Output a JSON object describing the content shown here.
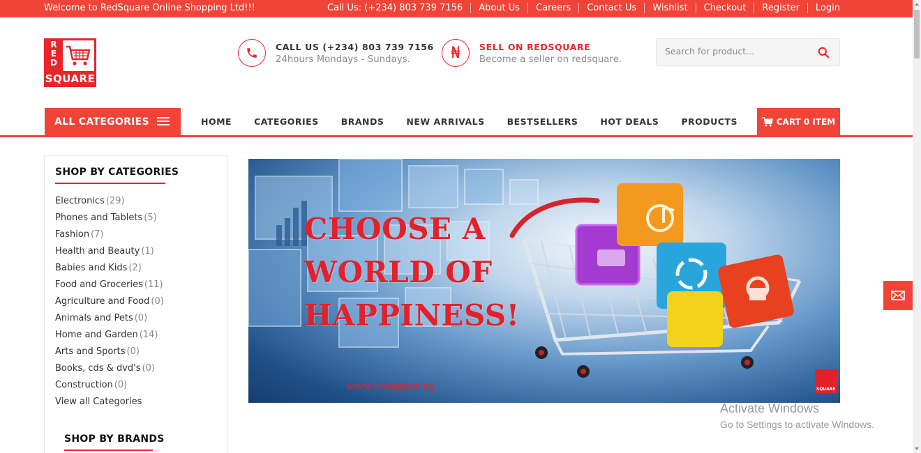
{
  "topbar": {
    "welcome": "Welcome to RedSquare Online Shopping Ltd!!!",
    "links": [
      "Call Us: (+234) 803 739 7156",
      "About Us",
      "Careers",
      "Contact Us",
      "Wishlist",
      "Checkout",
      "Register",
      "Login"
    ]
  },
  "logo": {
    "top": "RED",
    "bottom": "SQUARE"
  },
  "contact": {
    "title": "CALL US (+234) 803 739 7156",
    "subtitle": "24hours Mondays - Sundays.",
    "icon": "phone-icon"
  },
  "sell": {
    "title": "SELL ON REDSQUARE",
    "subtitle": "Become a seller on redsquare.",
    "icon": "naira-icon",
    "symbol": "₦"
  },
  "search": {
    "placeholder": "Search for product..."
  },
  "nav": {
    "all_categories": "ALL CATEGORIES",
    "items": [
      "HOME",
      "CATEGORIES",
      "BRANDS",
      "NEW ARRIVALS",
      "BESTSELLERS",
      "HOT DEALS",
      "PRODUCTS"
    ],
    "cart": "CART 0 ITEM"
  },
  "sidebar": {
    "heading": "SHOP BY CATEGORIES",
    "categories": [
      {
        "name": "Electronics",
        "count": "(29)"
      },
      {
        "name": "Phones and Tablets",
        "count": "(5)"
      },
      {
        "name": "Fashion",
        "count": "(7)"
      },
      {
        "name": "Health and Beauty",
        "count": "(1)"
      },
      {
        "name": "Babies and Kids",
        "count": "(2)"
      },
      {
        "name": "Food and Groceries",
        "count": "(11)"
      },
      {
        "name": "Agriculture and Food",
        "count": "(0)"
      },
      {
        "name": "Animals and Pets",
        "count": "(0)"
      },
      {
        "name": "Home and Garden",
        "count": "(14)"
      },
      {
        "name": "Arts and Sports",
        "count": "(0)"
      },
      {
        "name": "Books, cds & dvd's",
        "count": "(0)"
      },
      {
        "name": "Construction",
        "count": "(0)"
      }
    ],
    "view_all": "View all Categories",
    "brands_heading": "SHOP BY BRANDS"
  },
  "banner": {
    "line1": "CHOOSE A",
    "line2": "WORLD OF",
    "line3": "HAPPINESS!",
    "url": "www.redsquare.ng",
    "mini_logo": "SQUARE"
  },
  "watermark": {
    "line1": "Activate Windows",
    "line2": "Go to Settings to activate Windows."
  },
  "colors": {
    "brand_red": "#f04438",
    "logo_red": "#e9242a"
  }
}
